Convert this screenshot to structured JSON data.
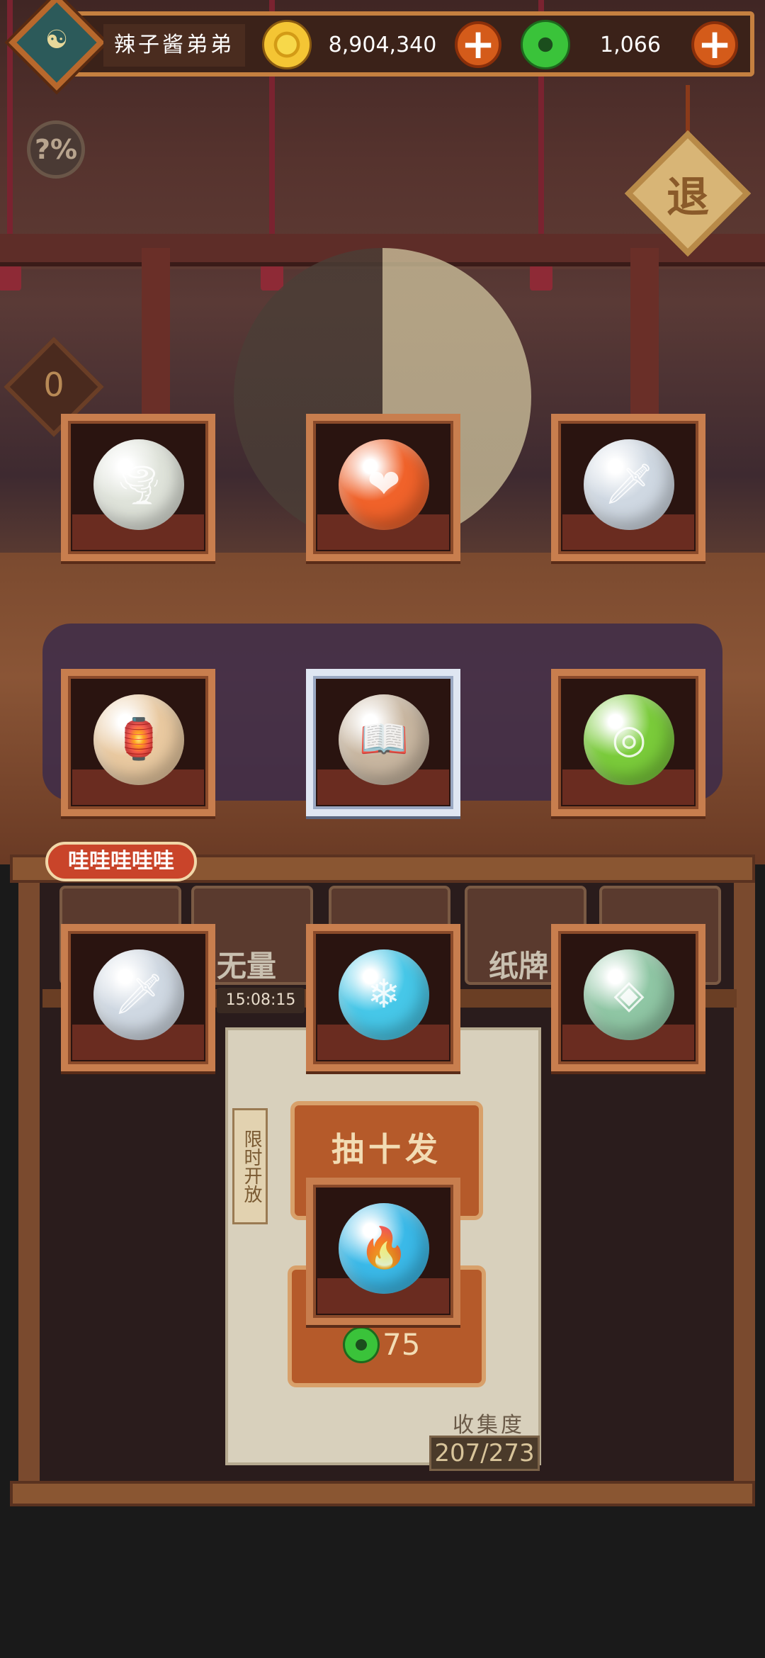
{
  "header": {
    "username": "辣子酱弟弟",
    "gold_amount": "8,904,340",
    "jade_amount": "1,066",
    "add_gold_label": "+",
    "add_jade_label": "+"
  },
  "side": {
    "help_label": "?%",
    "exit_label": "退",
    "counter_value": "0"
  },
  "gacha": {
    "speech_bubble": "哇哇哇哇哇",
    "tabs": [
      {
        "label": ""
      },
      {
        "label": "无量"
      },
      {
        "label": ""
      },
      {
        "label": "纸牌"
      },
      {
        "label": ""
      }
    ],
    "timer": "15:08:15",
    "limited_label": "限时开放",
    "draw_ten_label": "抽十发",
    "draw_one_cost": "75",
    "collection_label": "收集度",
    "collection_value": "207/273"
  },
  "rewards": [
    {
      "name": "tornado-orb",
      "color": "#dfe3da",
      "glyph": "🌪"
    },
    {
      "name": "fire-heart-orb",
      "color": "#f0622a",
      "glyph": "❤"
    },
    {
      "name": "cleaver-orb",
      "color": "#cfd8e2",
      "glyph": "🗡"
    },
    {
      "name": "pagoda-lantern-orb",
      "color": "#e9c9a0",
      "glyph": "🏮"
    },
    {
      "name": "spell-book",
      "color": "#c8b6a0",
      "glyph": "📖"
    },
    {
      "name": "green-swirl-orb",
      "color": "#7acb3a",
      "glyph": "◎"
    },
    {
      "name": "cleaver-orb-2",
      "color": "#cfd8e2",
      "glyph": "🗡"
    },
    {
      "name": "ice-crystal-orb",
      "color": "#46c7e8",
      "glyph": "❄"
    },
    {
      "name": "jade-shield-orb",
      "color": "#8fc6a4",
      "glyph": "◈"
    },
    {
      "name": "blue-flame-orb",
      "color": "#3ab9e8",
      "glyph": "🔥"
    }
  ]
}
